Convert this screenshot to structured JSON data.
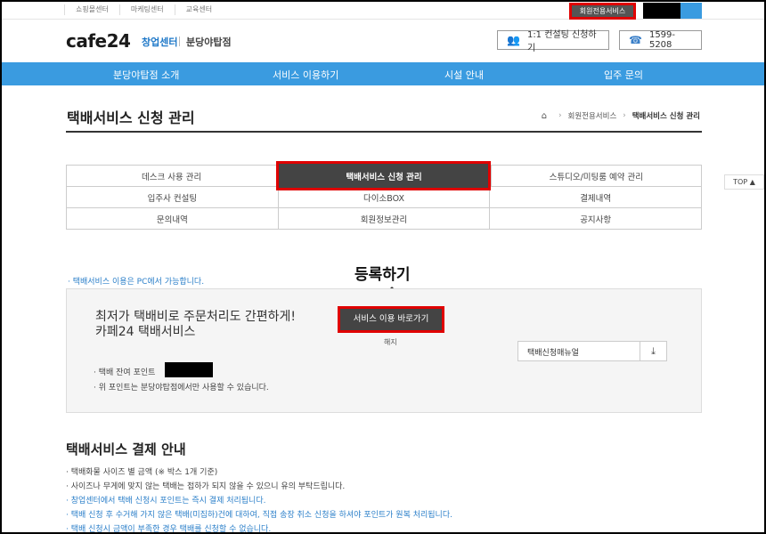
{
  "topbar": {
    "links": [
      "쇼핑몰센터",
      "마케팅센터",
      "교육센터"
    ],
    "member_service": "회원전용서비스"
  },
  "header": {
    "logo": "cafe24",
    "logo_sub": "창업센터",
    "logo_sub2": "분당야탑점",
    "consult_label": "1:1 컨설팅 신청하기",
    "phone_label": "1599-5208"
  },
  "nav": [
    "분당야탑점 소개",
    "서비스 이용하기",
    "시설 안내",
    "입주 문의"
  ],
  "page": {
    "title": "택배서비스 신청 관리",
    "breadcrumb": [
      "회원전용서비스",
      "택배서비스 신청 관리"
    ]
  },
  "menu": {
    "rows": [
      [
        "데스크 사용 관리",
        "택배서비스 신청 관리",
        "스튜디오/미팅룸 예약 관리"
      ],
      [
        "입주사 컨설팅",
        "다이소BOX",
        "결제내역"
      ],
      [
        "문의내역",
        "회원정보관리",
        "공지사항"
      ]
    ],
    "active": "택배서비스 신청 관리"
  },
  "top_link": "TOP ▲",
  "annotation": "등록하기",
  "note": "· 택배서비스 이용은 PC에서 가능합니다.",
  "service_box": {
    "headline1": "최저가 택배비로 주문처리도 간편하게!",
    "headline2": "카페24 택배서비스",
    "go_button": "서비스 이용 바로가기",
    "cancel": "해지",
    "manual_label": "택배신청매뉴얼",
    "points_label": "· 택배 잔여 포인트",
    "points_note": "· 위 포인트는 분당야탑점에서만 사용할 수 있습니다."
  },
  "payment": {
    "title": "택배서비스 결제 안내",
    "items": [
      {
        "text": "· 택배화물 사이즈 별 금액 (※ 박스 1개 기준)",
        "blue": false
      },
      {
        "text": "· 사이즈나 무게에 맞지 않는 택배는 접하가 되지 않을 수 있으니 유의 부탁드립니다.",
        "blue": false
      },
      {
        "text": "· 창업센터에서 택배 신청시 포인트는 즉시 결제 처리됩니다.",
        "blue": true
      },
      {
        "text": "· 택배 신청 후 수거해 가지 않은 택배(미집하)건에 대하여, 직접 송장 취소 신청을 하셔야 포인트가 원복 처리됩니다.",
        "blue": true
      },
      {
        "text": "· 택배 신청시 금액이 부족한 경우 택배를 신청할 수 없습니다.",
        "blue": true
      }
    ]
  },
  "colors": {
    "nav_blue": "#3a9be0",
    "highlight_red": "#e00000",
    "dark_button": "#444444"
  }
}
